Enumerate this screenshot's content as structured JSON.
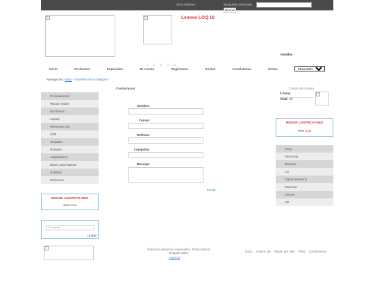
{
  "topbar": {
    "links_label": "Otros idiomas:",
    "search_label": "Búsqueda avanzada",
    "search_placeholder": "",
    "search_button": "Buscar"
  },
  "product": {
    "title": "Lenovo LOQ 16",
    "details_label": "Detalles",
    "pager": "1 2 3 4 5"
  },
  "nav": {
    "items": [
      "Inicio",
      "Productos",
      "Especiales",
      "Mi cuenta",
      "Registrarse",
      "Envíos",
      "Contáctanos",
      "Divisa"
    ],
    "currency_selected": "Peso MXN"
  },
  "breadcrumb": {
    "label": "Navegación:",
    "home": "Inicio",
    "separator": "»",
    "current": "Nombre de la categoría"
  },
  "sidebar": {
    "categories": [
      "Procesadores",
      "Placas madre",
      "Escritorios",
      "Laptop",
      "Memorias ram",
      "SSD",
      "Teclados",
      "Ratones",
      "Adaptadores",
      "Bases para laptops",
      "Gráficas",
      "Webcams"
    ]
  },
  "promo_left": {
    "title": "MOUSE LOGITECH G502",
    "old_price": "450$",
    "new_price": "320$"
  },
  "newsletter": {
    "placeholder": "Tu correo",
    "button": "Unirse"
  },
  "form": {
    "title": "Contáctanos",
    "name_label": "Nombre:",
    "email_label": "Correo:",
    "phone_label": "Teléfono:",
    "company_label": "Compañía:",
    "message_label": "Mensaje:",
    "send_label": "Enviar"
  },
  "cart": {
    "title": "Carrito de compra",
    "items": "0 items",
    "total_label": "Total:",
    "total_value": "0$"
  },
  "promo_right": {
    "title": "MOUSE LOGITECH G502",
    "old_price": "450$",
    "new_price": "320$"
  },
  "brands": {
    "items": [
      "Sony",
      "Samsung",
      "Daewoo",
      "LG",
      "Fujitsu Siemens",
      "Motorola",
      "Lenovo",
      "HP"
    ]
  },
  "footer": {
    "copyright": "Todos los derechos reservados. Pedro Marco Delgado 2025",
    "button": "Imprimir",
    "links": [
      "Inicio",
      "Acerca de",
      "Mapa del sitio",
      "RSS",
      "Contáctenos"
    ]
  },
  "colors": {
    "topbar": "#4a4a4a",
    "accent_red": "#d62b2b",
    "link_blue": "#3a7fd5",
    "border_blue": "#8bbcd8"
  }
}
